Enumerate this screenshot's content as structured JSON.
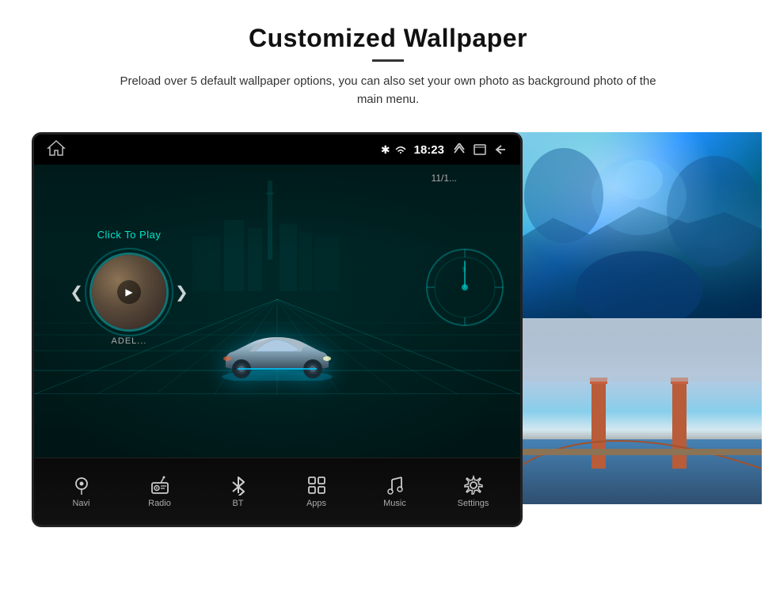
{
  "page": {
    "title": "Customized Wallpaper",
    "divider": true,
    "subtitle": "Preload over 5 default wallpaper options, you can also set your own photo as background photo of the main menu."
  },
  "screen": {
    "status_bar": {
      "time": "18:23",
      "bluetooth": "✱",
      "signal": true
    },
    "music": {
      "click_to_play": "Click To Play",
      "artist": "ADEL...",
      "date": "11/1..."
    },
    "nav_items": [
      {
        "label": "Navi",
        "icon": "location-icon"
      },
      {
        "label": "Radio",
        "icon": "radio-icon"
      },
      {
        "label": "BT",
        "icon": "bluetooth-icon"
      },
      {
        "label": "Apps",
        "icon": "apps-icon"
      },
      {
        "label": "Music",
        "icon": "music-icon"
      },
      {
        "label": "Settings",
        "icon": "settings-icon"
      }
    ]
  }
}
